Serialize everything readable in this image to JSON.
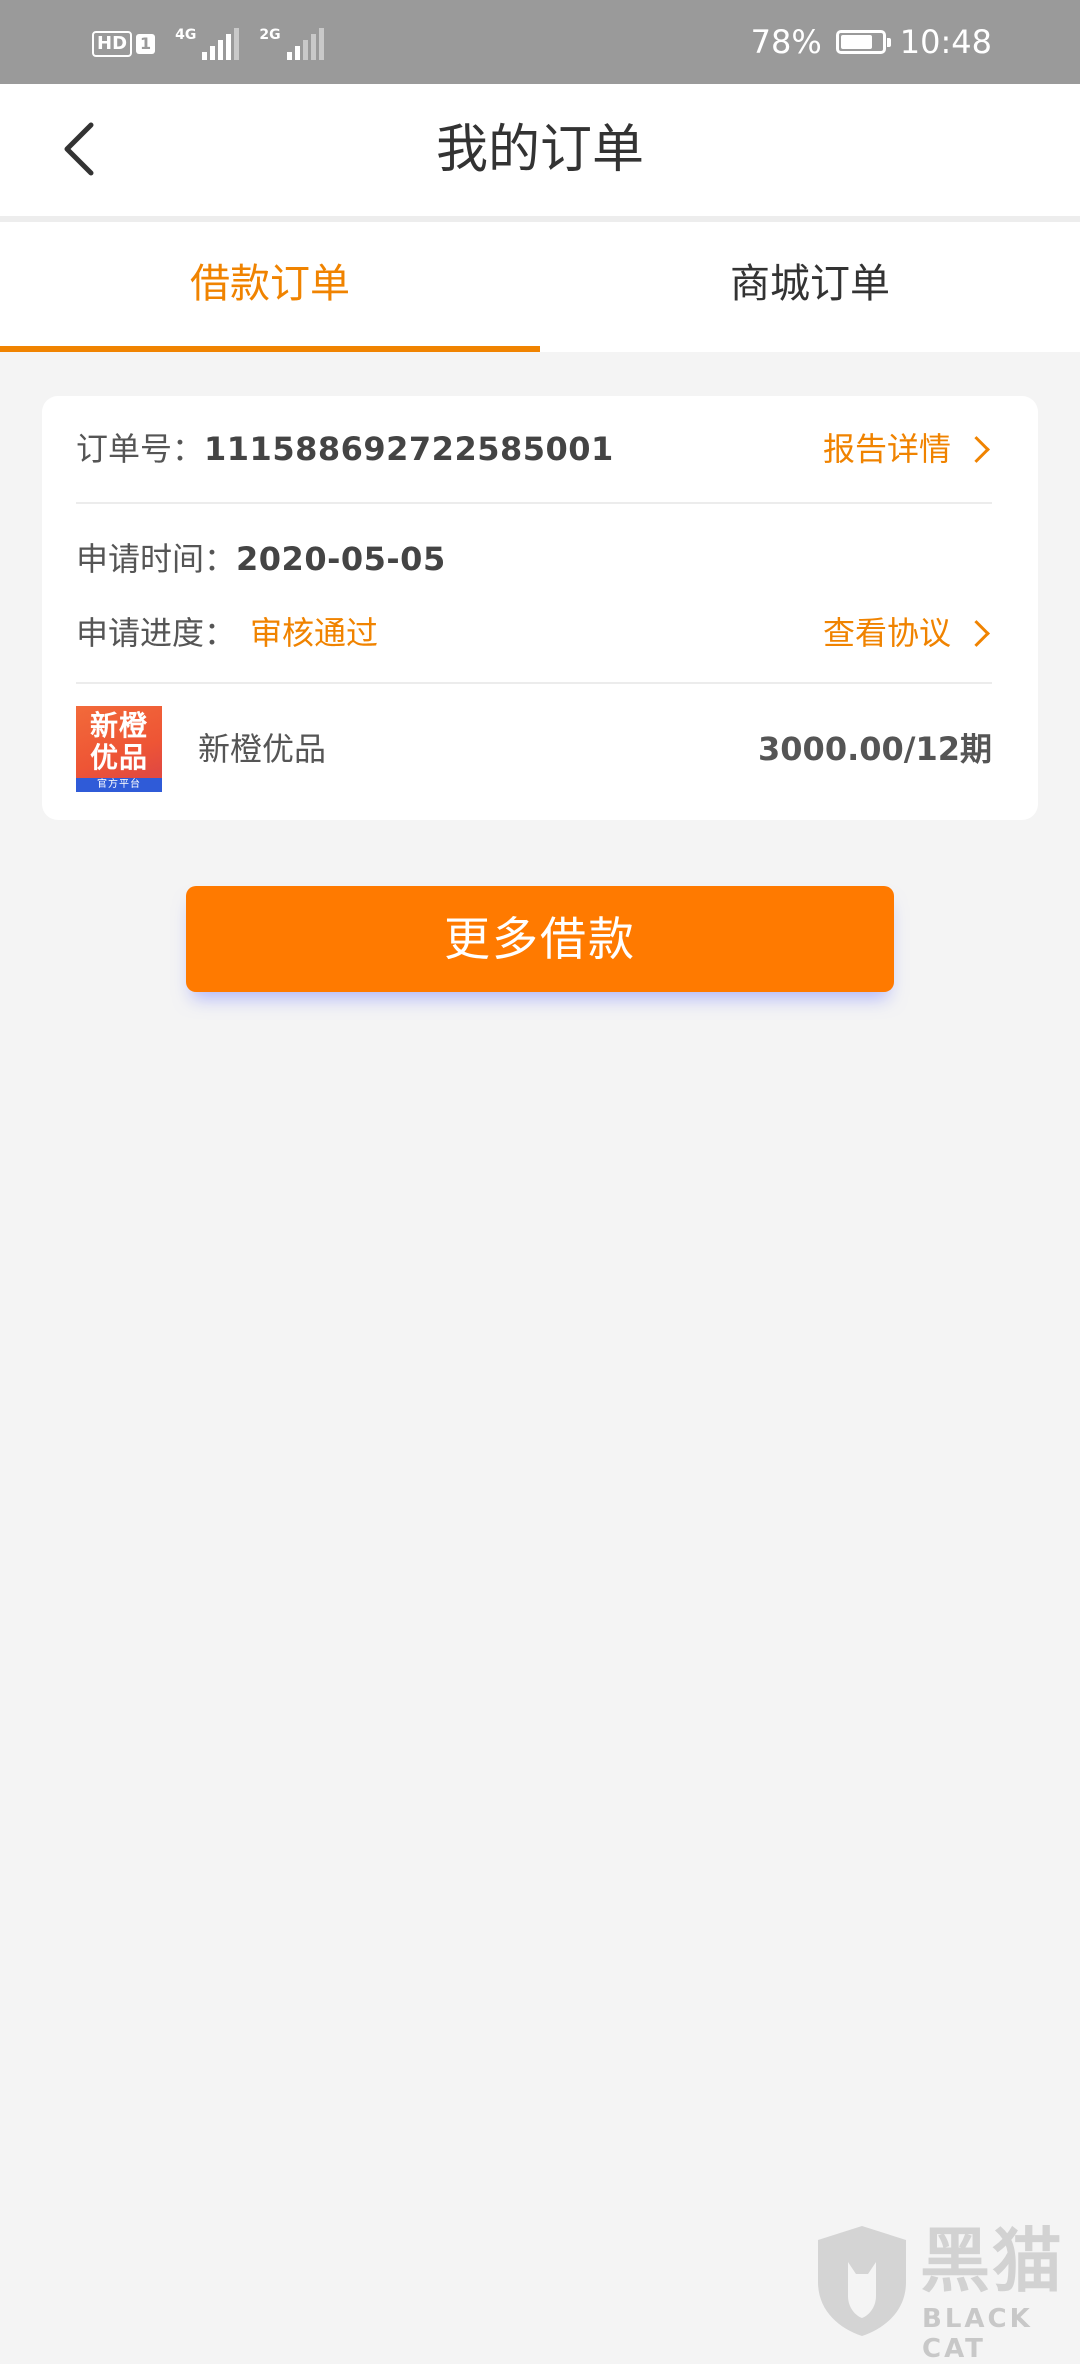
{
  "status_bar": {
    "hd_label": "HD",
    "hd_sim": "1",
    "net1_label": "4G",
    "net2_label": "2G",
    "battery_text": "78%",
    "battery_level": 0.78,
    "time": "10:48"
  },
  "header": {
    "title": "我的订单",
    "back_icon": "chevron-left-icon"
  },
  "tabs": [
    {
      "label": "借款订单",
      "active": true
    },
    {
      "label": "商城订单",
      "active": false
    }
  ],
  "order": {
    "number_label": "订单号：",
    "number": "11158869272258500​1",
    "report_link": "报告详情",
    "time_label": "申请时间：",
    "time": "2020-05-05",
    "progress_label": "申请进度：",
    "progress": "审核通过",
    "agreement_link": "查看协议",
    "product_logo_text": "新橙\n优品",
    "product_logo_sub": "官方平台",
    "product_name": "新橙优品",
    "amount": "3000.00/12期"
  },
  "action": {
    "more_button": "更多借款"
  },
  "watermark": {
    "title": "黑猫",
    "sub": "BLACK CAT"
  },
  "colors": {
    "accent": "#f08300",
    "button": "#ff7a00",
    "status_bar": "#9a9a9a",
    "background": "#f4f4f4"
  }
}
